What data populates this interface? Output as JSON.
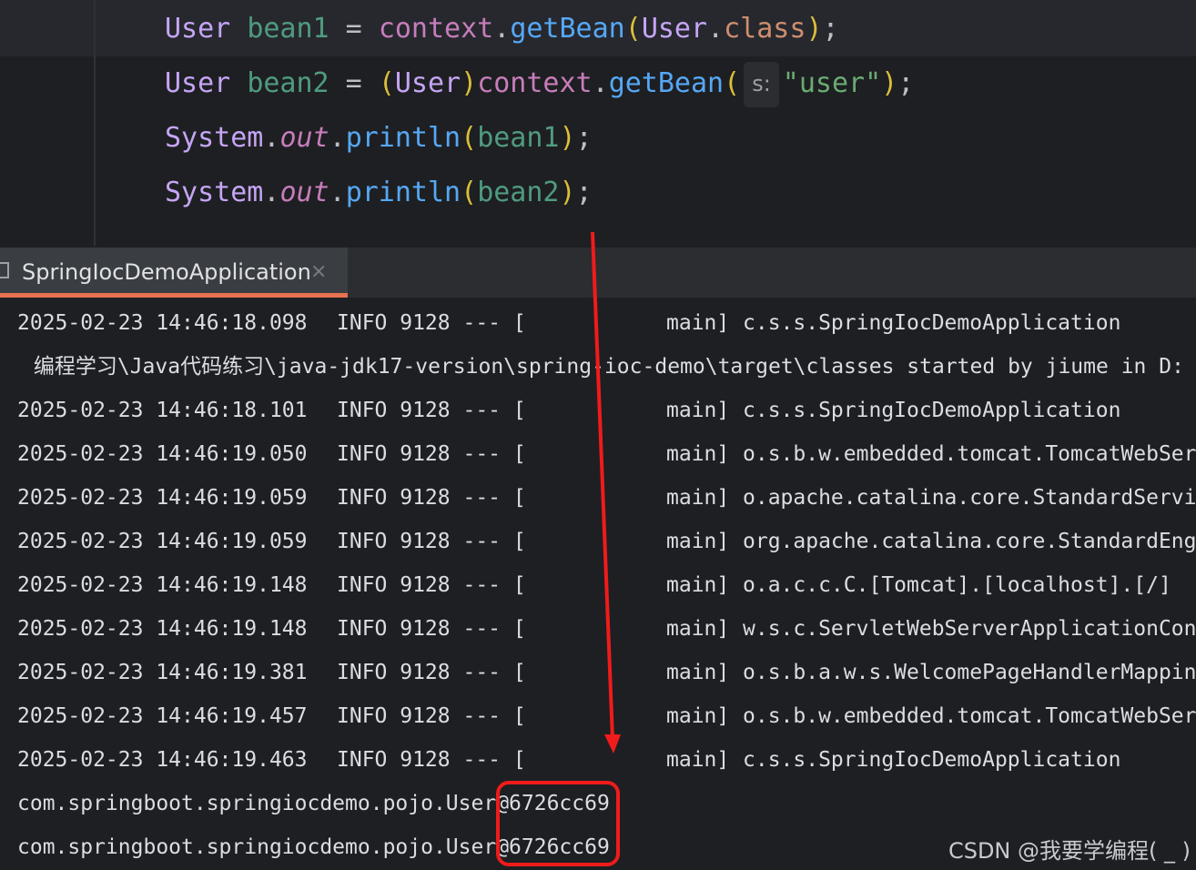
{
  "editor": {
    "lines": [
      {
        "tokens": [
          {
            "t": "User",
            "c": "t-type"
          },
          {
            "t": " ",
            "c": "t-plain"
          },
          {
            "t": "bean1",
            "c": "t-local"
          },
          {
            "t": " = ",
            "c": "t-plain"
          },
          {
            "t": "context",
            "c": "t-field"
          },
          {
            "t": ".",
            "c": "t-plain"
          },
          {
            "t": "getBean",
            "c": "t-method"
          },
          {
            "t": "(",
            "c": "t-paren"
          },
          {
            "t": "User",
            "c": "t-type"
          },
          {
            "t": ".",
            "c": "t-plain"
          },
          {
            "t": "class",
            "c": "t-kw"
          },
          {
            "t": ")",
            "c": "t-paren"
          },
          {
            "t": ";",
            "c": "t-plain"
          }
        ]
      },
      {
        "tokens": [
          {
            "t": "User",
            "c": "t-type"
          },
          {
            "t": " ",
            "c": "t-plain"
          },
          {
            "t": "bean2",
            "c": "t-local"
          },
          {
            "t": " = ",
            "c": "t-plain"
          },
          {
            "t": "(",
            "c": "t-paren"
          },
          {
            "t": "User",
            "c": "t-type"
          },
          {
            "t": ")",
            "c": "t-paren"
          },
          {
            "t": "context",
            "c": "t-field"
          },
          {
            "t": ".",
            "c": "t-plain"
          },
          {
            "t": "getBean",
            "c": "t-method"
          },
          {
            "t": "(",
            "c": "t-paren"
          },
          {
            "t": "s:",
            "c": "hint"
          },
          {
            "t": "\"user\"",
            "c": "t-str"
          },
          {
            "t": ")",
            "c": "t-paren"
          },
          {
            "t": ";",
            "c": "t-plain"
          }
        ]
      },
      {
        "tokens": [
          {
            "t": "System",
            "c": "t-type"
          },
          {
            "t": ".",
            "c": "t-plain"
          },
          {
            "t": "out",
            "c": "t-static"
          },
          {
            "t": ".",
            "c": "t-plain"
          },
          {
            "t": "println",
            "c": "t-method"
          },
          {
            "t": "(",
            "c": "t-paren"
          },
          {
            "t": "bean1",
            "c": "t-local"
          },
          {
            "t": ")",
            "c": "t-paren"
          },
          {
            "t": ";",
            "c": "t-plain"
          }
        ]
      },
      {
        "tokens": [
          {
            "t": "System",
            "c": "t-type"
          },
          {
            "t": ".",
            "c": "t-plain"
          },
          {
            "t": "out",
            "c": "t-static"
          },
          {
            "t": ".",
            "c": "t-plain"
          },
          {
            "t": "println",
            "c": "t-method"
          },
          {
            "t": "(",
            "c": "t-paren"
          },
          {
            "t": "bean2",
            "c": "t-local"
          },
          {
            "t": ")",
            "c": "t-paren"
          },
          {
            "t": ";",
            "c": "t-plain"
          }
        ]
      }
    ]
  },
  "run_tab": {
    "label": "SpringIocDemoApplication",
    "close_glyph": "×",
    "icon": "console-icon"
  },
  "console": {
    "log_rows": [
      {
        "ts": "2025-02-23 14:46:18.098",
        "level": "INFO 9128 --- [",
        "thread": "main]",
        "logger": "c.s.s.SpringIocDemoApplication"
      },
      {
        "text": " 编程学习\\Java代码练习\\java-jdk17-version\\spring-ioc-demo\\target\\classes started by jiume in D:"
      },
      {
        "ts": "2025-02-23 14:46:18.101",
        "level": "INFO 9128 --- [",
        "thread": "main]",
        "logger": "c.s.s.SpringIocDemoApplication"
      },
      {
        "ts": "2025-02-23 14:46:19.050",
        "level": "INFO 9128 --- [",
        "thread": "main]",
        "logger": "o.s.b.w.embedded.tomcat.TomcatWebSer"
      },
      {
        "ts": "2025-02-23 14:46:19.059",
        "level": "INFO 9128 --- [",
        "thread": "main]",
        "logger": "o.apache.catalina.core.StandardServi"
      },
      {
        "ts": "2025-02-23 14:46:19.059",
        "level": "INFO 9128 --- [",
        "thread": "main]",
        "logger": "org.apache.catalina.core.StandardEng"
      },
      {
        "ts": "2025-02-23 14:46:19.148",
        "level": "INFO 9128 --- [",
        "thread": "main]",
        "logger": "o.a.c.c.C.[Tomcat].[localhost].[/]"
      },
      {
        "ts": "2025-02-23 14:46:19.148",
        "level": "INFO 9128 --- [",
        "thread": "main]",
        "logger": "w.s.c.ServletWebServerApplicationCon"
      },
      {
        "ts": "2025-02-23 14:46:19.381",
        "level": "INFO 9128 --- [",
        "thread": "main]",
        "logger": "o.s.b.a.w.s.WelcomePageHandlerMappin"
      },
      {
        "ts": "2025-02-23 14:46:19.457",
        "level": "INFO 9128 --- [",
        "thread": "main]",
        "logger": "o.s.b.w.embedded.tomcat.TomcatWebSer"
      },
      {
        "ts": "2025-02-23 14:46:19.463",
        "level": "INFO 9128 --- [",
        "thread": "main]",
        "logger": "c.s.s.SpringIocDemoApplication"
      },
      {
        "text": "com.springboot.springiocdemo.pojo.User@6726cc69"
      },
      {
        "text": "com.springboot.springiocdemo.pojo.User@6726cc69"
      }
    ]
  },
  "watermark": "CSDN @我要学编程( _ )",
  "colors": {
    "annotation_red": "#f01b1b",
    "tab_accent": "#e8714f",
    "background": "#1e1f22"
  }
}
